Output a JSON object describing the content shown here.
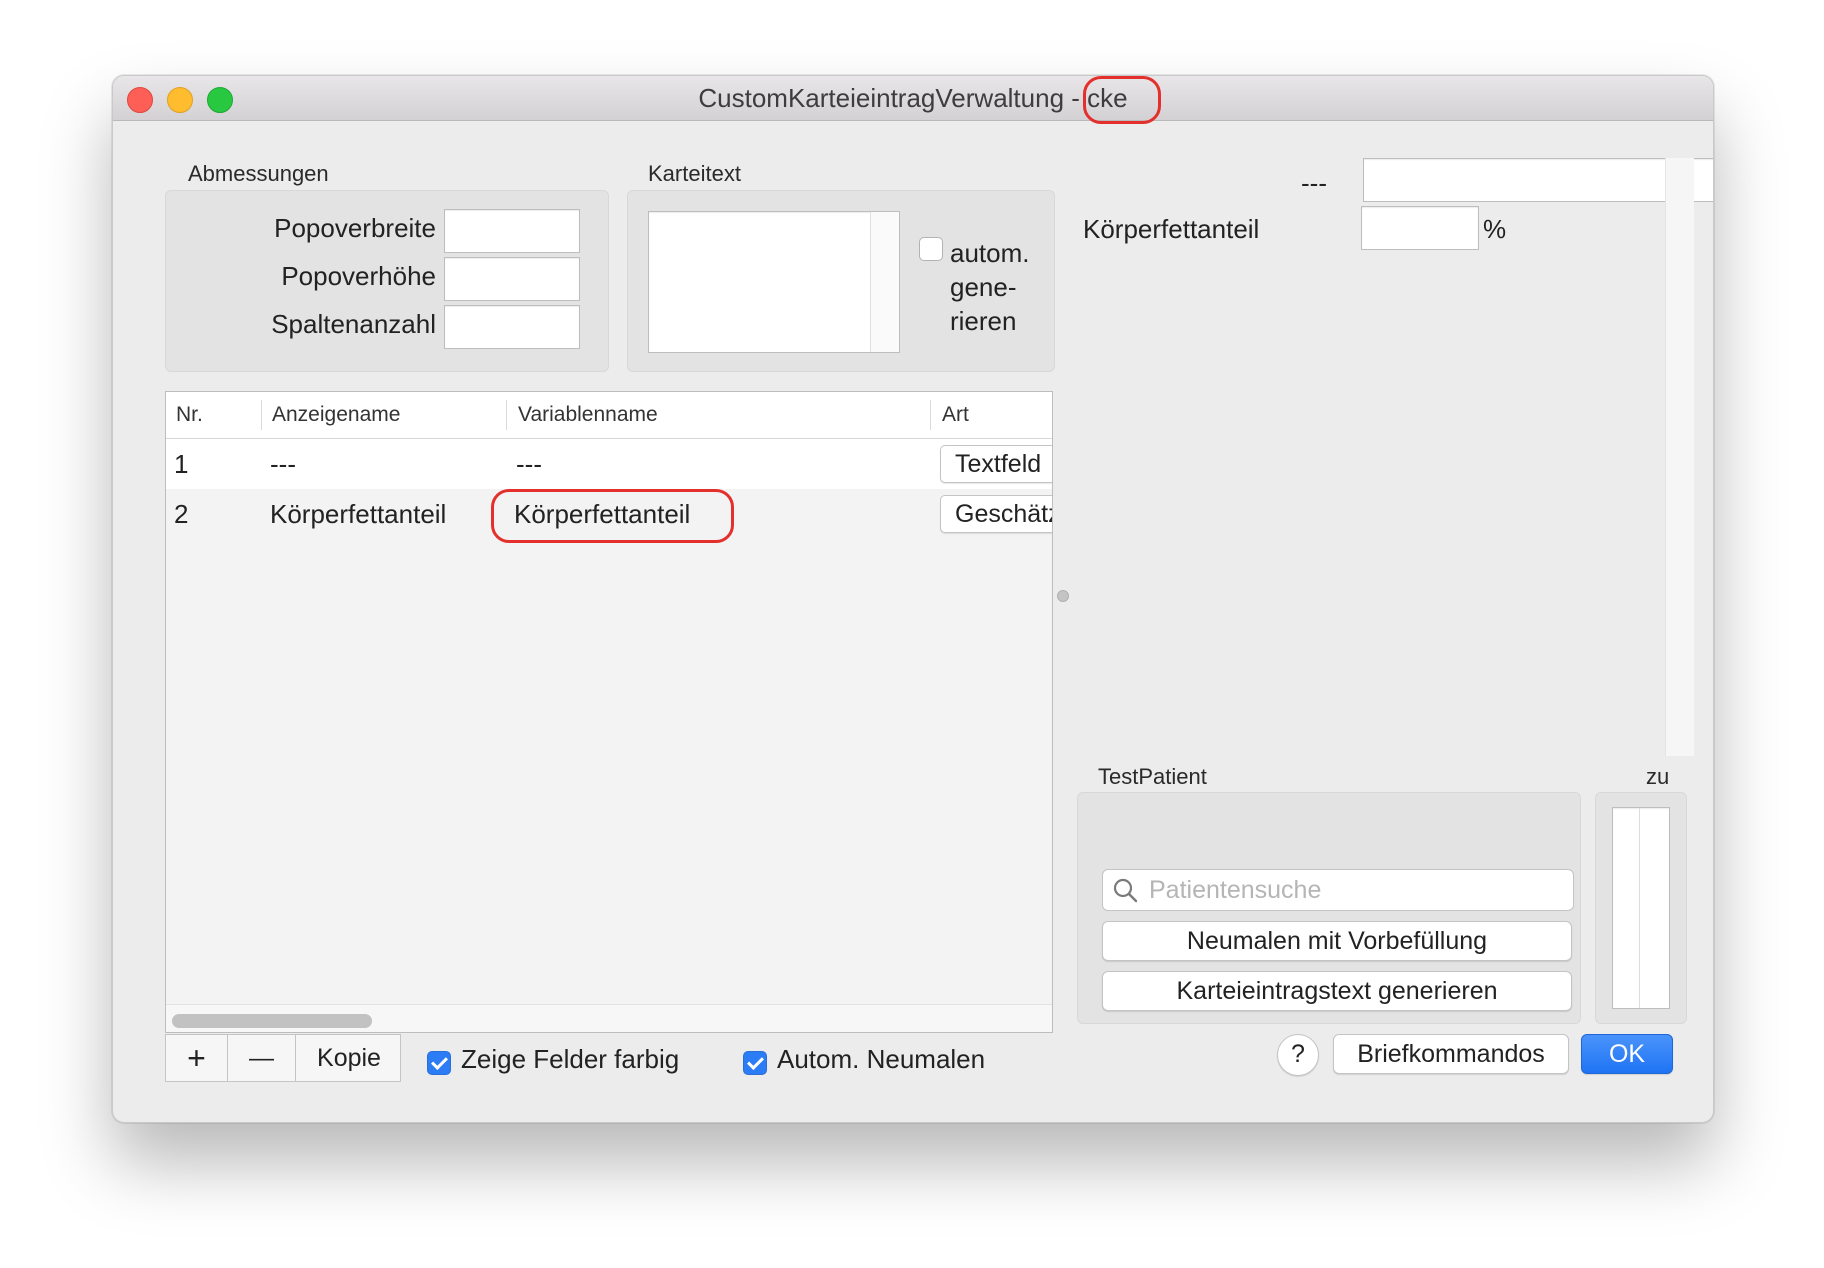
{
  "window": {
    "title": "CustomKarteieintragVerwaltung - cke"
  },
  "dimensions": {
    "label": "Abmessungen",
    "fields": [
      {
        "label": "Popoverbreite",
        "value": ""
      },
      {
        "label": "Popoverhöhe",
        "value": ""
      },
      {
        "label": "Spaltenanzahl",
        "value": ""
      }
    ]
  },
  "karteitext": {
    "label": "Karteitext",
    "value": "",
    "auto_generate": {
      "line1": "autom.",
      "line2": "gene-",
      "line3": "rieren",
      "checked": false
    }
  },
  "table": {
    "columns": [
      "Nr.",
      "Anzeigename",
      "Variablenname",
      "Art"
    ],
    "rows": [
      {
        "nr": "1",
        "anzeigename": "---",
        "variablenname": "---",
        "art": "Textfeld"
      },
      {
        "nr": "2",
        "anzeigename": "Körperfettanteil",
        "variablenname": "Körperfettanteil",
        "art": "Geschätzt"
      }
    ]
  },
  "toolbar": {
    "add": "+",
    "remove": "—",
    "copy": "Kopie",
    "show_colored": {
      "label": "Zeige Felder farbig",
      "checked": true
    },
    "auto_repaint": {
      "label": "Autom. Neumalen",
      "checked": true
    }
  },
  "preview": {
    "field1_label": "---",
    "field1_value": "",
    "field2_label": "Körperfettanteil",
    "field2_value": "",
    "field2_unit": "%"
  },
  "test_patient": {
    "label": "TestPatient",
    "search_placeholder": "Patientensuche",
    "repaint_button": "Neumalen mit Vorbefüllung",
    "generate_button": "Karteieintragstext generieren"
  },
  "zu": {
    "label": "zu"
  },
  "footer": {
    "help": "?",
    "letter_commands": "Briefkommandos",
    "ok": "OK"
  },
  "colors": {
    "accent": "#2c7cf6",
    "highlight": "#e3302c"
  }
}
